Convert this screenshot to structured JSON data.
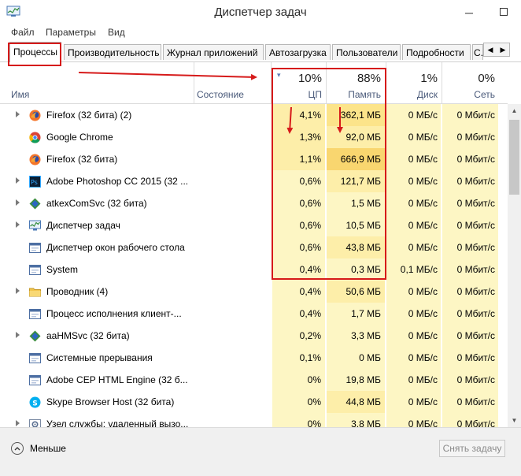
{
  "window": {
    "title": "Диспетчер задач"
  },
  "menu": [
    "Файл",
    "Параметры",
    "Вид"
  ],
  "tabs": [
    {
      "label": "Процессы",
      "active": true
    },
    {
      "label": "Производительность"
    },
    {
      "label": "Журнал приложений"
    },
    {
      "label": "Автозагрузка"
    },
    {
      "label": "Пользователи"
    },
    {
      "label": "Подробности"
    },
    {
      "label": "С..."
    }
  ],
  "columns": {
    "name": "Имя",
    "status": "Состояние",
    "cpu": {
      "label": "ЦП",
      "percent": "10%"
    },
    "memory": {
      "label": "Память",
      "percent": "88%"
    },
    "disk": {
      "label": "Диск",
      "percent": "1%"
    },
    "network": {
      "label": "Сеть",
      "percent": "0%"
    }
  },
  "processes": [
    {
      "name": "Firefox (32 бита) (2)",
      "icon": "firefox-icon",
      "expandable": true,
      "cpu": "4,1%",
      "memory": "362,1 МБ",
      "disk": "0 МБ/с",
      "network": "0 Мбит/с",
      "cpu_level": 1,
      "mem_level": 2
    },
    {
      "name": "Google Chrome",
      "icon": "chrome-icon",
      "expandable": false,
      "cpu": "1,3%",
      "memory": "92,0 МБ",
      "disk": "0 МБ/с",
      "network": "0 Мбит/с",
      "cpu_level": 1,
      "mem_level": 1
    },
    {
      "name": "Firefox (32 бита)",
      "icon": "firefox-icon",
      "expandable": false,
      "cpu": "1,1%",
      "memory": "666,9 МБ",
      "disk": "0 МБ/с",
      "network": "0 Мбит/с",
      "cpu_level": 1,
      "mem_level": 3
    },
    {
      "name": "Adobe Photoshop CC 2015 (32 ...",
      "icon": "photoshop-icon",
      "expandable": true,
      "cpu": "0,6%",
      "memory": "121,7 МБ",
      "disk": "0 МБ/с",
      "network": "0 Мбит/с",
      "cpu_level": 0,
      "mem_level": 1
    },
    {
      "name": "atkexComSvc (32 бита)",
      "icon": "service-icon",
      "expandable": true,
      "cpu": "0,6%",
      "memory": "1,5 МБ",
      "disk": "0 МБ/с",
      "network": "0 Мбит/с",
      "cpu_level": 0,
      "mem_level": 0
    },
    {
      "name": "Диспетчер задач",
      "icon": "task-manager-icon",
      "expandable": true,
      "cpu": "0,6%",
      "memory": "10,5 МБ",
      "disk": "0 МБ/с",
      "network": "0 Мбит/с",
      "cpu_level": 0,
      "mem_level": 0
    },
    {
      "name": "Диспетчер окон рабочего стола",
      "icon": "window-icon",
      "expandable": false,
      "cpu": "0,6%",
      "memory": "43,8 МБ",
      "disk": "0 МБ/с",
      "network": "0 Мбит/с",
      "cpu_level": 0,
      "mem_level": 1
    },
    {
      "name": "System",
      "icon": "window-icon",
      "expandable": false,
      "cpu": "0,4%",
      "memory": "0,3 МБ",
      "disk": "0,1 МБ/с",
      "network": "0 Мбит/с",
      "cpu_level": 0,
      "mem_level": 0
    },
    {
      "name": "Проводник (4)",
      "icon": "folder-icon",
      "expandable": true,
      "cpu": "0,4%",
      "memory": "50,6 МБ",
      "disk": "0 МБ/с",
      "network": "0 Мбит/с",
      "cpu_level": 0,
      "mem_level": 1
    },
    {
      "name": "Процесс исполнения клиент-...",
      "icon": "window-icon",
      "expandable": false,
      "cpu": "0,4%",
      "memory": "1,7 МБ",
      "disk": "0 МБ/с",
      "network": "0 Мбит/с",
      "cpu_level": 0,
      "mem_level": 0
    },
    {
      "name": "aaHMSvc (32 бита)",
      "icon": "service-icon",
      "expandable": true,
      "cpu": "0,2%",
      "memory": "3,3 МБ",
      "disk": "0 МБ/с",
      "network": "0 Мбит/с",
      "cpu_level": 0,
      "mem_level": 0
    },
    {
      "name": "Системные прерывания",
      "icon": "window-icon",
      "expandable": false,
      "cpu": "0,1%",
      "memory": "0 МБ",
      "disk": "0 МБ/с",
      "network": "0 Мбит/с",
      "cpu_level": 0,
      "mem_level": 0
    },
    {
      "name": "Adobe CEP HTML Engine (32 б...",
      "icon": "window-icon",
      "expandable": false,
      "cpu": "0%",
      "memory": "19,8 МБ",
      "disk": "0 МБ/с",
      "network": "0 Мбит/с",
      "cpu_level": 0,
      "mem_level": 0
    },
    {
      "name": "Skype Browser Host (32 бита)",
      "icon": "skype-icon",
      "expandable": false,
      "cpu": "0%",
      "memory": "44,8 МБ",
      "disk": "0 МБ/с",
      "network": "0 Мбит/с",
      "cpu_level": 0,
      "mem_level": 1
    },
    {
      "name": "Узел службы: удаленный вызо...",
      "icon": "gear-icon",
      "expandable": true,
      "cpu": "0%",
      "memory": "3,8 МБ",
      "disk": "0 МБ/с",
      "network": "0 Мбит/с",
      "cpu_level": 0,
      "mem_level": 0
    }
  ],
  "footer": {
    "less_label": "Меньше",
    "end_task_label": "Снять задачу"
  },
  "colors": {
    "annotation_red": "#d61a1a",
    "heat_low": "#fdf6c4",
    "heat_mid": "#fdeea9",
    "heat_high": "#fce48a",
    "heat_max": "#f9d66f"
  }
}
